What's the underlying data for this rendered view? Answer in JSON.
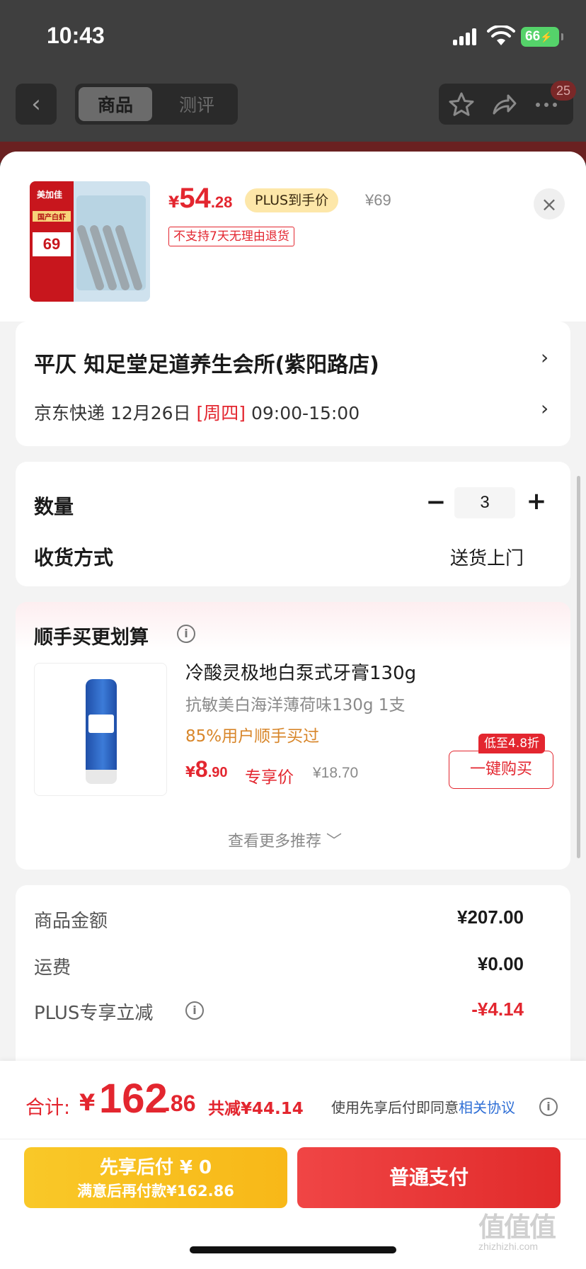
{
  "status_bar": {
    "time": "10:43",
    "battery": "66"
  },
  "bg_nav": {
    "tabs": [
      {
        "label": "商品",
        "active": true
      },
      {
        "label": "测评",
        "active": false
      }
    ],
    "badge": "25"
  },
  "product": {
    "price_symbol": "¥",
    "price_int": "54",
    "price_dec": ".28",
    "plus_label": "PLUS到手价",
    "original_price": "¥69",
    "return_notice": "不支持7天无理由退货",
    "thumb_brand": "美加佳",
    "thumb_tag": "国产白虾",
    "thumb_price": "69"
  },
  "address": {
    "line": "平仄  知足堂足道养生会所(紫阳路店)",
    "courier": "京东快递 12月26日",
    "weekday": "[周四]",
    "time_range": "09:00-15:00"
  },
  "quantity": {
    "label": "数量",
    "value": "3",
    "minus": "−",
    "plus": "+"
  },
  "shipping": {
    "label": "收货方式",
    "value": "送货上门"
  },
  "recommend": {
    "title": "顺手买更划算",
    "item": {
      "name": "冷酸灵极地白泵式牙膏130g",
      "subtitle": "抗敏美白海洋薄荷味130g 1支",
      "percent": "85%用户顺手买过",
      "price_symbol": "¥",
      "price_int": "8",
      "price_dec": ".90",
      "exclusive": "专享价",
      "original_price": "¥18.70",
      "discount_tag": "低至4.8折",
      "buy_label": "一键购买"
    },
    "more": "查看更多推荐 ﹀"
  },
  "summary": [
    {
      "label": "商品金额",
      "value": "¥207.00",
      "red": false,
      "info": false
    },
    {
      "label": "运费",
      "value": "¥0.00",
      "red": false,
      "info": false
    },
    {
      "label": "PLUS专享立减",
      "value": "-¥4.14",
      "red": true,
      "info": true
    }
  ],
  "footer": {
    "total_label": "合计:",
    "total_symbol": "¥",
    "total_int": "162",
    "total_dec": ".86",
    "total_reduce": "共减¥44.14",
    "agree_prefix": "使用先享后付即同意",
    "agree_link": "相关协议",
    "pay_later_main": "先享后付 ¥ 0",
    "pay_later_sub": "满意后再付款¥162.86",
    "pay_normal": "普通支付",
    "watermark": "值值值",
    "watermark_sub": "zhizhizhi.com"
  }
}
